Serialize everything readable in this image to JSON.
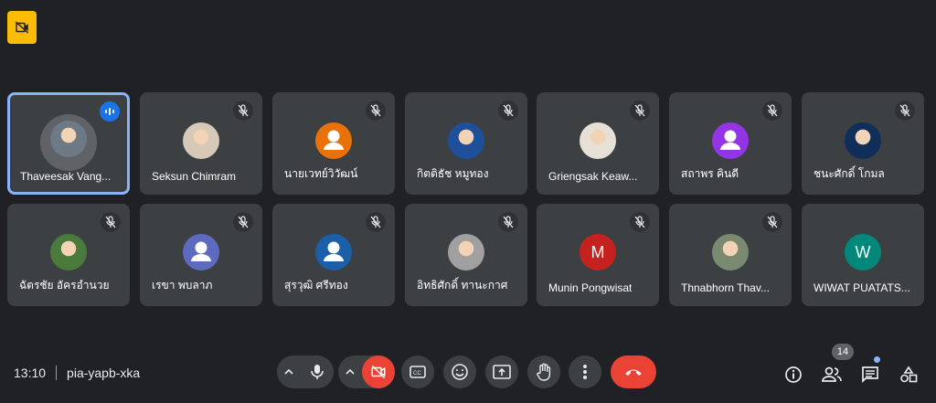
{
  "meeting": {
    "time": "13:10",
    "code": "pia-yapb-xka"
  },
  "participants_count": "14",
  "colors": {
    "background": "#202124",
    "tile": "#3c4043",
    "active_border": "#8ab4f8",
    "hangup": "#ea4335"
  },
  "participants": [
    {
      "name": "Thaveesak Vang...",
      "avatar": "photo",
      "speaking": true
    },
    {
      "name": "Seksun Chimram",
      "avatar": "photo",
      "muted": true
    },
    {
      "name": "นายเวทย์วิวัฒน์",
      "avatar": "person-icon",
      "avatar_color": "#e8710a",
      "muted": true
    },
    {
      "name": "กิตติธัช หมูทอง",
      "avatar": "photo",
      "muted": true
    },
    {
      "name": "Griengsak Keaw...",
      "avatar": "photo",
      "muted": true
    },
    {
      "name": "สถาพร คินดี",
      "avatar": "person-icon",
      "avatar_color": "#9334e6",
      "muted": true
    },
    {
      "name": "ชนะศักดิ์ โกมล",
      "avatar": "photo",
      "muted": true
    },
    {
      "name": "ฉัตรชัย อัครอำนวย",
      "avatar": "photo",
      "muted": true
    },
    {
      "name": "เรขา พบลาภ",
      "avatar": "person-icon",
      "avatar_color": "#5c6bc0",
      "muted": true
    },
    {
      "name": "สุรวุฒิ ศรีทอง",
      "avatar": "person-icon",
      "avatar_color": "#1a5fa8",
      "muted": true
    },
    {
      "name": "อิทธิศักดิ์ ทานะกาศ",
      "avatar": "photo",
      "muted": true
    },
    {
      "name": "Munin Pongwisat",
      "avatar": "letter",
      "letter": "M",
      "avatar_color": "#c5221f",
      "muted": true
    },
    {
      "name": "Thnabhorn Thav...",
      "avatar": "photo",
      "muted": true
    },
    {
      "name": "WIWAT PUATATS...",
      "avatar": "letter",
      "letter": "W",
      "avatar_color": "#00897b",
      "muted": false
    }
  ],
  "controls": [
    "mic-icon",
    "camera-off-icon",
    "captions-icon",
    "emoji-icon",
    "present-icon",
    "raise-hand-icon",
    "more-options-icon",
    "hang-up-icon"
  ],
  "right_icons": [
    "info-icon",
    "people-icon",
    "chat-icon",
    "activities-icon"
  ]
}
